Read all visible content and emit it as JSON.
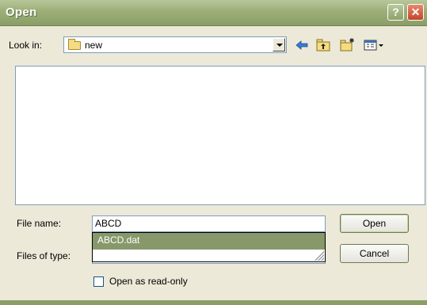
{
  "window": {
    "title": "Open",
    "help_glyph": "?",
    "close_glyph": "✕"
  },
  "toolbar": {
    "look_in_label": "Look in:",
    "look_in_value": "new",
    "icons": [
      "back-arrow-icon",
      "up-folder-icon",
      "new-folder-icon",
      "view-menu-icon"
    ]
  },
  "form": {
    "file_name_label": "File name:",
    "file_name_value": "ABCD",
    "files_of_type_label": "Files of type:",
    "files_of_type_value": "",
    "read_only_label": "Open as read-only",
    "read_only_checked": false
  },
  "buttons": {
    "open": "Open",
    "cancel": "Cancel"
  },
  "autocomplete": {
    "items": [
      "ABCD.dat"
    ]
  },
  "colors": {
    "titlebar": "#9fb07a",
    "dialog_bg": "#ece9d8",
    "selection": "#87986b",
    "field_border": "#7f9db9"
  }
}
